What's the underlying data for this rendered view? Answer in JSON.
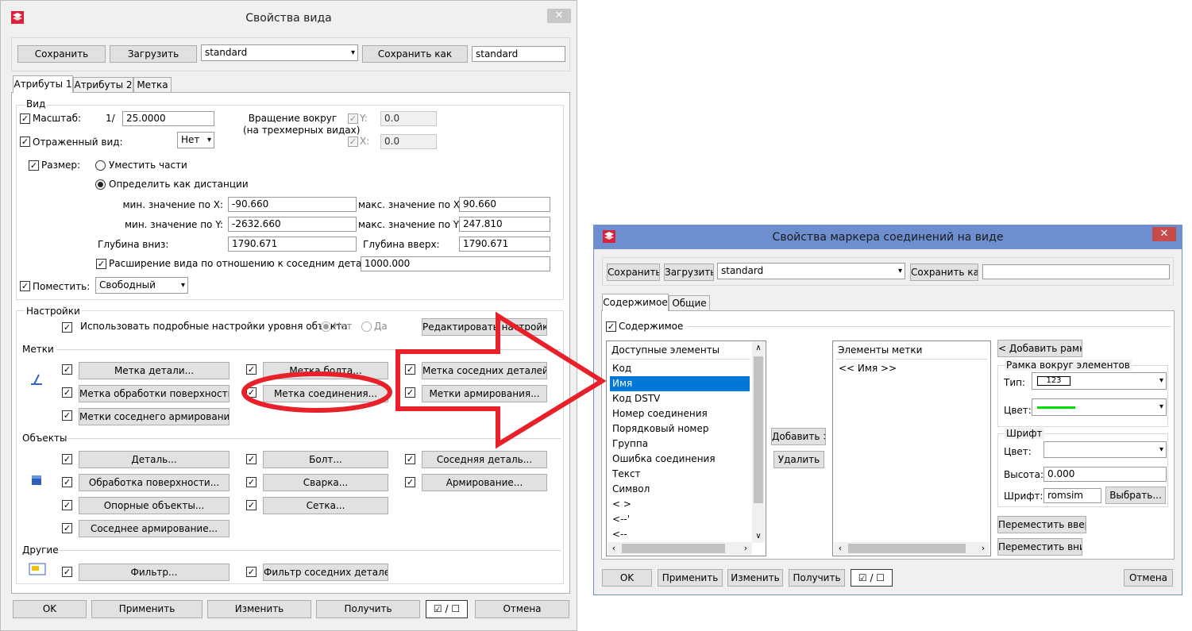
{
  "colors": {
    "accent_blue": "#6d8ecf",
    "selection": "#0078d7",
    "annotation_red": "#e8202a",
    "line_green": "#00e000"
  },
  "dialog1": {
    "title": "Свойства вида",
    "top": {
      "save": "Сохранить",
      "load": "Загрузить",
      "preset": "standard",
      "save_as": "Сохранить как",
      "save_as_name": "standard"
    },
    "tabs": [
      "Атрибуты 1",
      "Атрибуты 2",
      "Метка"
    ],
    "view": {
      "group": "Вид",
      "scale_label": "Масштаб:",
      "scale_prefix": "1/",
      "scale_value": "25.0000",
      "rotation_label_1": "Вращение вокруг",
      "rotation_label_2": "(на трехмерных видах)",
      "rot_y_label": "Y:",
      "rot_y_value": "0.0",
      "rot_x_label": "X:",
      "rot_x_value": "0.0",
      "mirror_label": "Отраженный вид:",
      "mirror_value": "Нет",
      "size_label": "Размер:",
      "fit_parts": "Уместить части",
      "define_distance": "Определить как дистанции",
      "min_x_label": "мин. значение по X:",
      "min_x": "-90.660",
      "max_x_label": "макс. значение по X:",
      "max_x": "90.660",
      "min_y_label": "мин. значение по Y:",
      "min_y": "-2632.660",
      "max_y_label": "макс. значение по Y:",
      "max_y": "247.810",
      "depth_down_label": "Глубина вниз:",
      "depth_down": "1790.671",
      "depth_up_label": "Глубина вверх:",
      "depth_up": "1790.671",
      "extension_label": "Расширение вида по отношению к соседним деталям:",
      "extension": "1000.000",
      "place_label": "Поместить:",
      "place_value": "Свободный"
    },
    "settings": {
      "group": "Настройки",
      "detailed_label": "Использовать подробные настройки уровня объекта",
      "no": "Нет",
      "yes": "Да",
      "edit_button": "Редактировать настройки..."
    },
    "marks": {
      "group": "Метки",
      "part_mark": "Метка детали...",
      "bolt_mark": "Метка болта...",
      "neighbor_mark": "Метка соседних деталей...",
      "surface_mark": "Метка обработки поверхности...",
      "connection_mark": "Метка соединения...",
      "rebar_mark": "Метки армирования...",
      "neighbor_rebar_mark": "Метки соседнего армирования..."
    },
    "objects": {
      "group": "Объекты",
      "part": "Деталь...",
      "bolt": "Болт...",
      "neighbor_part": "Соседняя деталь...",
      "surface": "Обработка поверхности...",
      "weld": "Сварка...",
      "rebar": "Армирование...",
      "reference": "Опорные объекты...",
      "grid": "Сетка...",
      "neighbor_rebar": "Соседнее армирование..."
    },
    "others": {
      "group": "Другие",
      "filter": "Фильтр...",
      "neighbor_filter": "Фильтр соседних деталей..."
    },
    "bottom": {
      "ok": "OK",
      "apply": "Применить",
      "modify": "Изменить",
      "get": "Получить",
      "toggle": "☑ / ☐",
      "cancel": "Отмена"
    }
  },
  "dialog2": {
    "title": "Свойства маркера соединений на виде",
    "top": {
      "save": "Сохранить",
      "load": "Загрузить",
      "preset": "standard",
      "save_as": "Сохранить как",
      "save_as_name": ""
    },
    "tabs": [
      "Содержимое",
      "Общие"
    ],
    "content_label": "Содержимое",
    "available_header": "Доступные элементы",
    "available_items": [
      "Код",
      "Имя",
      "Код DSTV",
      "Номер соединения",
      "Порядковый номер",
      "Группа",
      "Ошибка соединения",
      "Текст",
      "Символ",
      "<  >",
      "<--'",
      "<--"
    ],
    "selected_index": 1,
    "mark_header": "Элементы метки",
    "mark_items": [
      "<< Имя >>"
    ],
    "add": "Добавить >",
    "remove": "Удалить",
    "add_frame": "< Добавить рамку",
    "frame_group": "Рамка вокруг элементов",
    "type_label": "Тип:",
    "type_value": "123",
    "color_label": "Цвет:",
    "font_group": "Шрифт",
    "font_color_label": "Цвет:",
    "height_label": "Высота:",
    "height_value": "0.000",
    "font_label": "Шрифт:",
    "font_value": "romsim",
    "choose": "Выбрать...",
    "move_up": "Переместить вверх",
    "move_down": "Переместить вниз",
    "bottom": {
      "ok": "OK",
      "apply": "Применить",
      "modify": "Изменить",
      "get": "Получить",
      "toggle": "☑ / ☐",
      "cancel": "Отмена"
    }
  }
}
